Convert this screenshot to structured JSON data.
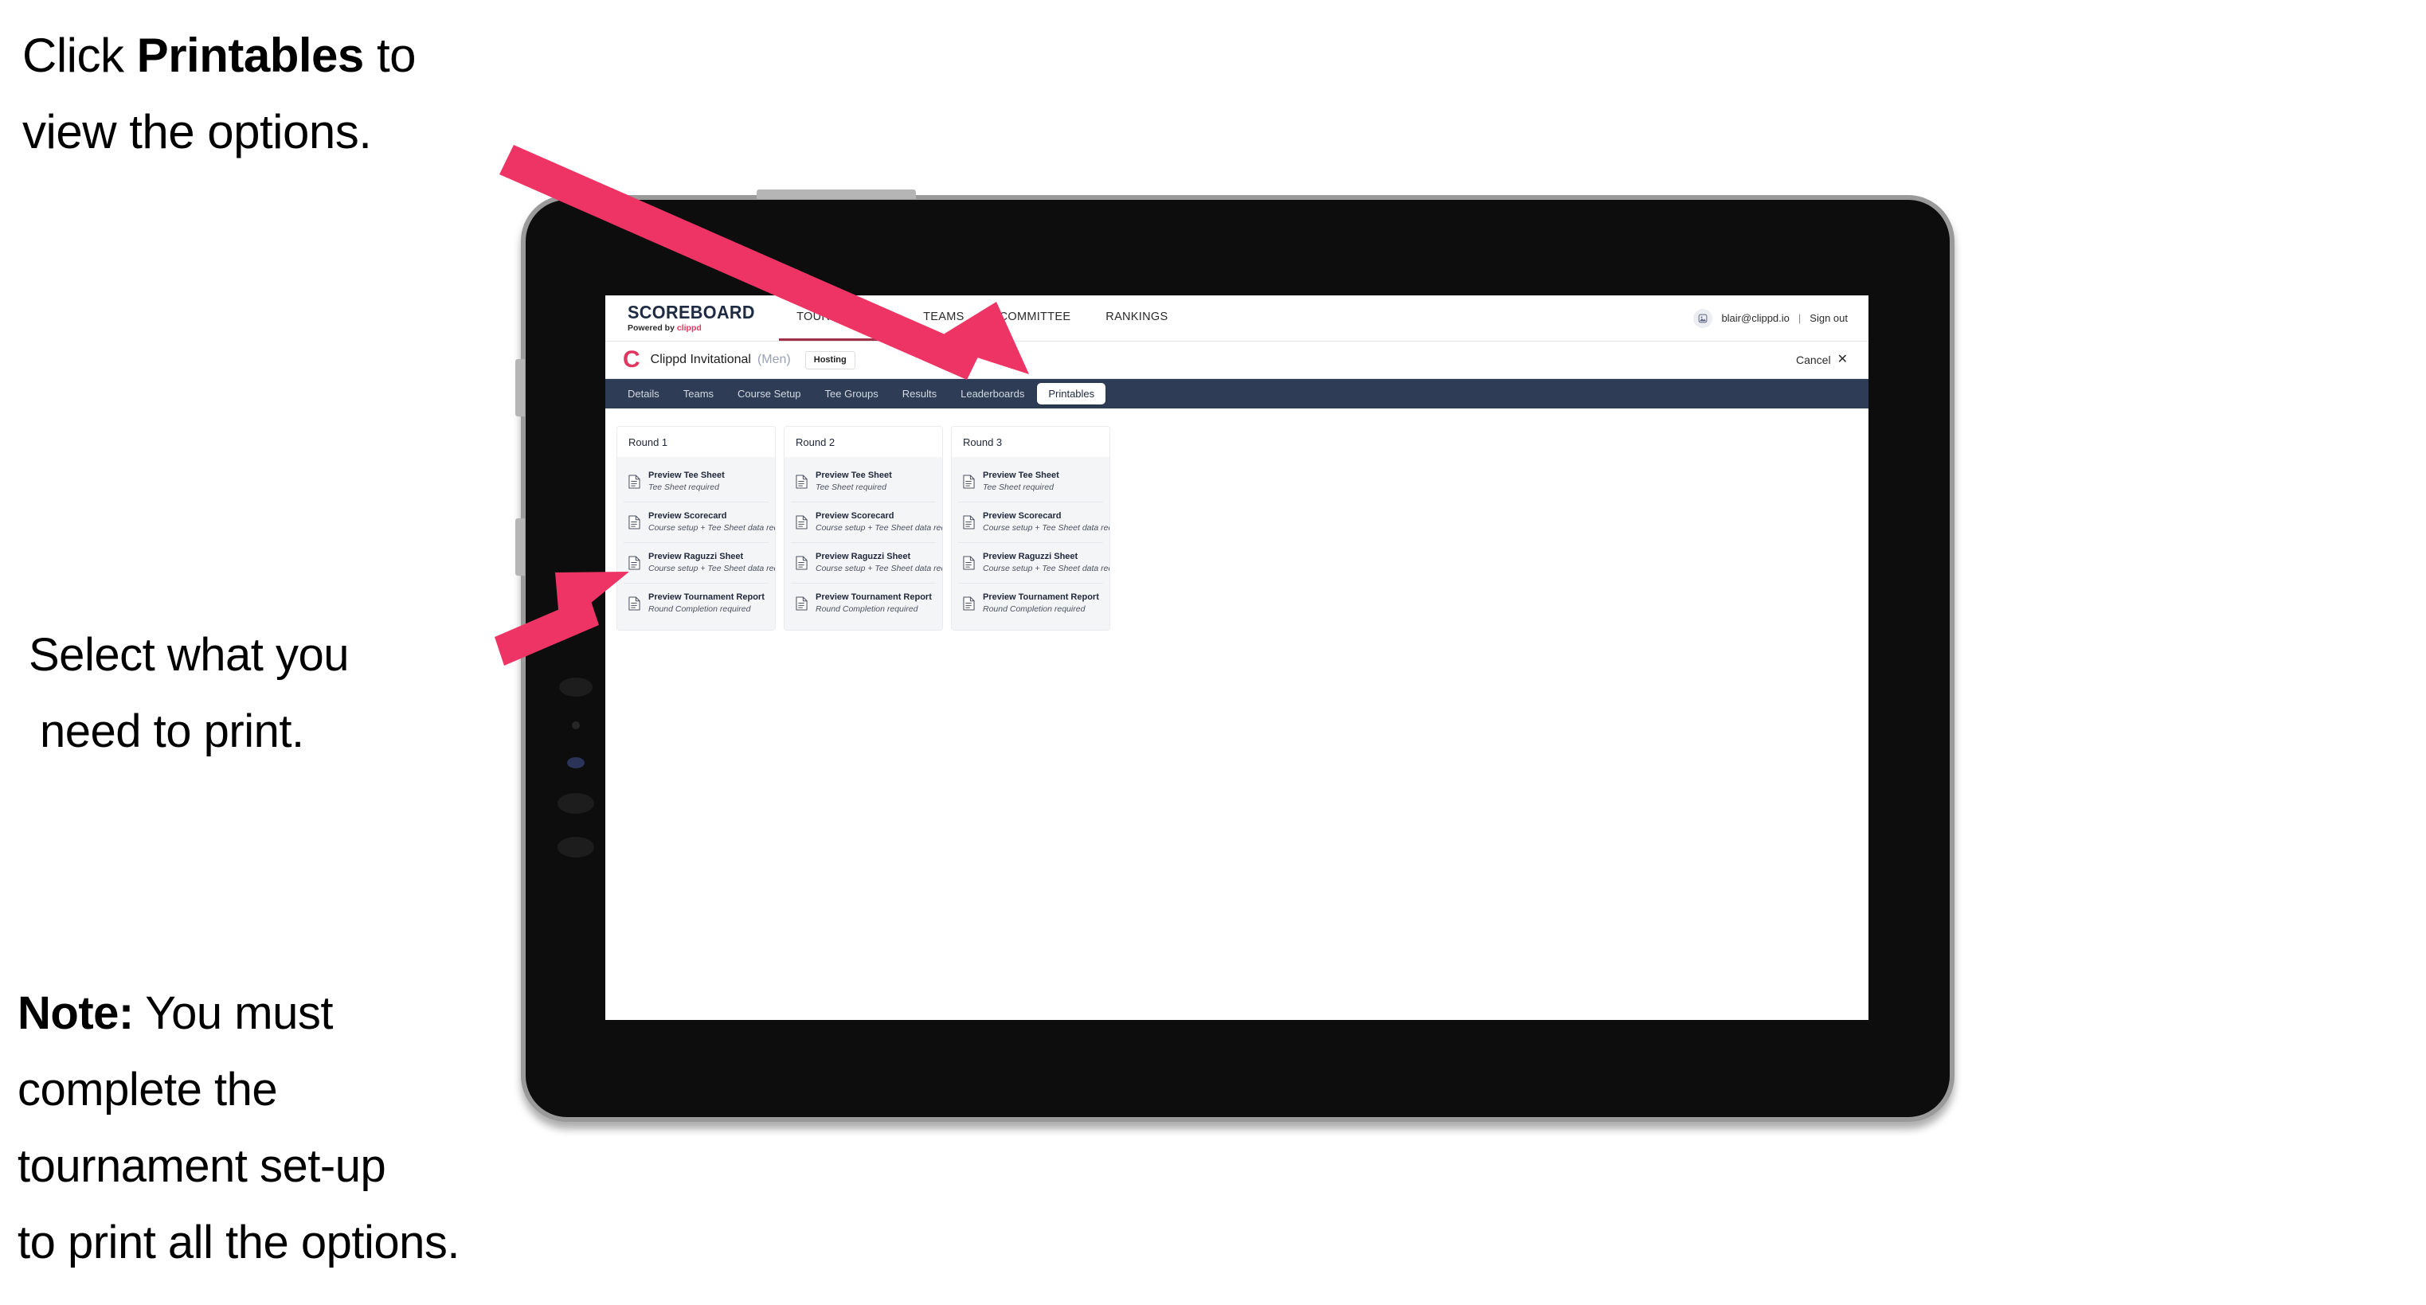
{
  "callouts": {
    "click_line1_pre": "Click ",
    "click_bold": "Printables",
    "click_line1_post": " to",
    "click_line2": "view the options.",
    "select_line1": "Select what you",
    "select_line2": "need to print.",
    "note_bold": "Note:",
    "note_line1_rest": " You must",
    "note_line2": "complete the",
    "note_line3": "tournament set-up",
    "note_line4": "to print all the options."
  },
  "colors": {
    "arrow_pink": "#ee3465",
    "brand_pink": "#e8355f",
    "subnav_navy": "#2e3d55",
    "active_underline": "#a3304a"
  },
  "app": {
    "brand": {
      "title": "SCOREBOARD",
      "sub_prefix": "Powered by ",
      "sub_brand": "clippd"
    },
    "main_nav": [
      {
        "label": "TOURNAMENTS",
        "active": true
      },
      {
        "label": "TEAMS",
        "active": false
      },
      {
        "label": "COMMITTEE",
        "active": false
      },
      {
        "label": "RANKINGS",
        "active": false
      }
    ],
    "user": {
      "avatar_icon": "user-avatar-icon",
      "email": "blair@clippd.io",
      "separator": "|",
      "sign_out": "Sign out"
    },
    "tournament": {
      "logo_letter": "C",
      "name": "Clippd Invitational",
      "gender": "(Men)",
      "status_badge": "Hosting",
      "cancel_label": "Cancel",
      "cancel_icon": "close-x-icon"
    },
    "sub_nav": [
      {
        "label": "Details",
        "active": false
      },
      {
        "label": "Teams",
        "active": false
      },
      {
        "label": "Course Setup",
        "active": false
      },
      {
        "label": "Tee Groups",
        "active": false
      },
      {
        "label": "Results",
        "active": false
      },
      {
        "label": "Leaderboards",
        "active": false
      },
      {
        "label": "Printables",
        "active": true
      }
    ],
    "rounds": [
      {
        "title": "Round 1",
        "items": [
          {
            "title": "Preview Tee Sheet",
            "sub": "Tee Sheet required"
          },
          {
            "title": "Preview Scorecard",
            "sub": "Course setup + Tee Sheet data required"
          },
          {
            "title": "Preview Raguzzi Sheet",
            "sub": "Course setup + Tee Sheet data required"
          },
          {
            "title": "Preview Tournament Report",
            "sub": "Round Completion required"
          }
        ]
      },
      {
        "title": "Round 2",
        "items": [
          {
            "title": "Preview Tee Sheet",
            "sub": "Tee Sheet required"
          },
          {
            "title": "Preview Scorecard",
            "sub": "Course setup + Tee Sheet data required"
          },
          {
            "title": "Preview Raguzzi Sheet",
            "sub": "Course setup + Tee Sheet data required"
          },
          {
            "title": "Preview Tournament Report",
            "sub": "Round Completion required"
          }
        ]
      },
      {
        "title": "Round 3",
        "items": [
          {
            "title": "Preview Tee Sheet",
            "sub": "Tee Sheet required"
          },
          {
            "title": "Preview Scorecard",
            "sub": "Course setup + Tee Sheet data required"
          },
          {
            "title": "Preview Raguzzi Sheet",
            "sub": "Course setup + Tee Sheet data required"
          },
          {
            "title": "Preview Tournament Report",
            "sub": "Round Completion required"
          }
        ]
      }
    ]
  }
}
